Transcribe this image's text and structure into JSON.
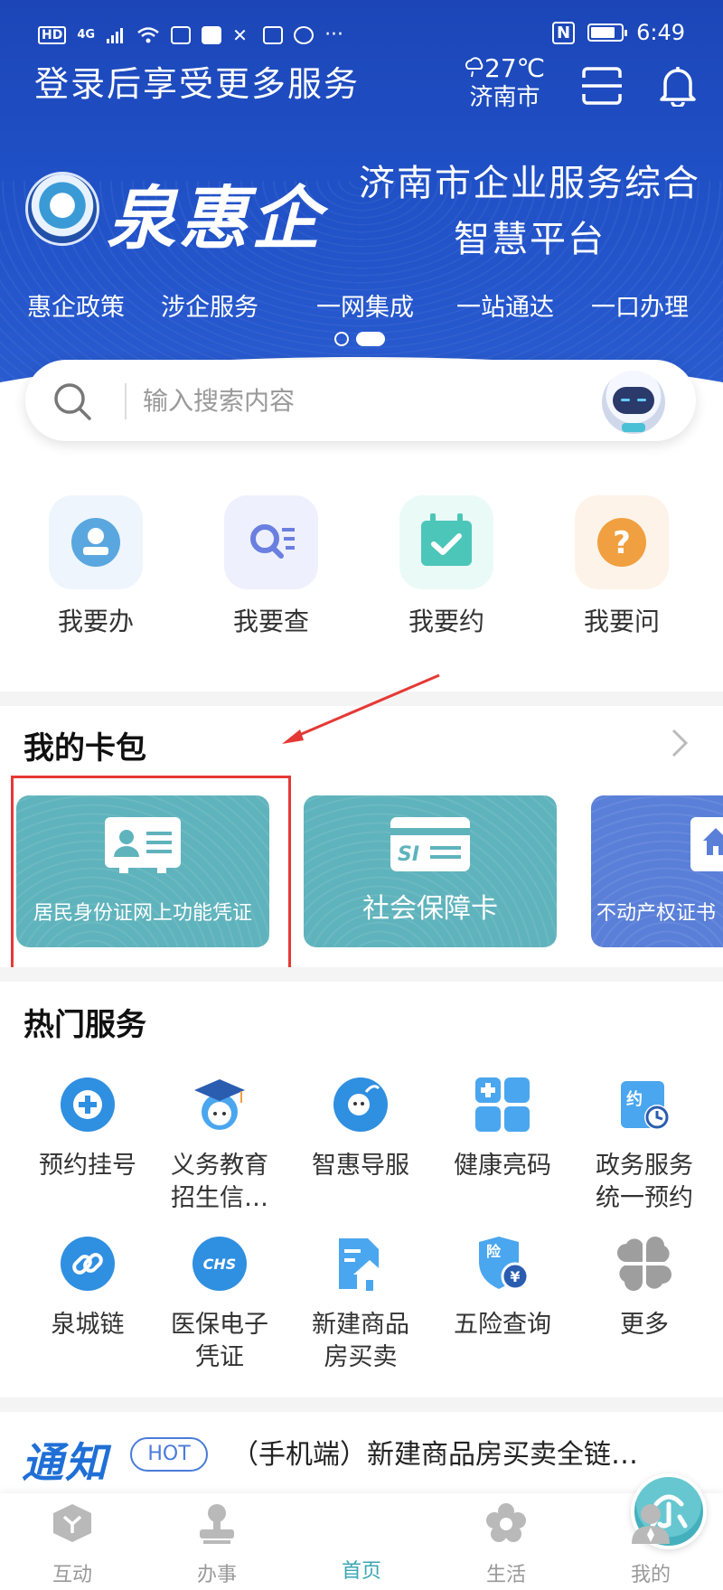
{
  "status_bar": {
    "hd": "HD",
    "network": "4G",
    "more": "···",
    "time": "6:49"
  },
  "header": {
    "login_prompt": "登录后享受更多服务",
    "weather_temp": "27℃",
    "weather_city": "济南市",
    "brand_name": "泉惠企",
    "brand_title_line1": "济南市企业服务综合",
    "brand_title_line2": "智慧平台"
  },
  "banner_nav": [
    "惠企政策",
    "涉企服务",
    "一网集成",
    "一站通达",
    "一口办理"
  ],
  "search": {
    "placeholder": "输入搜索内容"
  },
  "quick_actions": [
    {
      "label": "我要办",
      "icon": "person-stamp-icon",
      "color": "#5aa7e0",
      "bg": "#eef5fd"
    },
    {
      "label": "我要查",
      "icon": "magnifier-list-icon",
      "color": "#6a7fe0",
      "bg": "#eef0fd"
    },
    {
      "label": "我要约",
      "icon": "calendar-check-icon",
      "color": "#4cc6b8",
      "bg": "#eafaf7"
    },
    {
      "label": "我要问",
      "icon": "question-icon",
      "color": "#f0a040",
      "bg": "#fdf3e8"
    }
  ],
  "card_wallet": {
    "title": "我的卡包",
    "cards": [
      {
        "label": "居民身份证网上功能凭证",
        "icon": "id-card-icon"
      },
      {
        "label": "社会保障卡",
        "icon": "si-card-icon"
      },
      {
        "label": "不动产权证书",
        "icon": "house-certificate-icon"
      }
    ]
  },
  "hot_services": {
    "title": "热门服务",
    "items": [
      {
        "label": "预约挂号",
        "icon": "medical-cross-icon"
      },
      {
        "label": "义务教育招生信…",
        "icon": "graduate-cap-icon"
      },
      {
        "label": "智惠导服",
        "icon": "mascot-guide-icon"
      },
      {
        "label": "健康亮码",
        "icon": "health-code-icon"
      },
      {
        "label": "政务服务统一预约",
        "icon": "appointment-clock-icon"
      },
      {
        "label": "泉城链",
        "icon": "chain-link-icon"
      },
      {
        "label": "医保电子凭证",
        "icon": "chs-insurance-icon"
      },
      {
        "label": "新建商品房买卖",
        "icon": "house-document-icon"
      },
      {
        "label": "五险查询",
        "icon": "insurance-shield-icon"
      },
      {
        "label": "更多",
        "icon": "more-grid-icon"
      }
    ]
  },
  "notice": {
    "logo": "通知",
    "badge": "HOT",
    "text": "（手机端）新建商品房买卖全链…"
  },
  "bottom_nav": [
    {
      "label": "互动",
      "icon": "interact-box-icon"
    },
    {
      "label": "办事",
      "icon": "stamp-icon"
    },
    {
      "label": "首页",
      "icon": "home-logo-icon"
    },
    {
      "label": "生活",
      "icon": "flower-icon"
    },
    {
      "label": "我的",
      "icon": "user-icon"
    }
  ],
  "colors": {
    "banner_blue": "#1f4fc4",
    "accent_teal": "#3aa6b3",
    "card_teal": "#5fb3bc",
    "card_blue": "#5a7fd8",
    "annotation_red": "#e53935"
  }
}
